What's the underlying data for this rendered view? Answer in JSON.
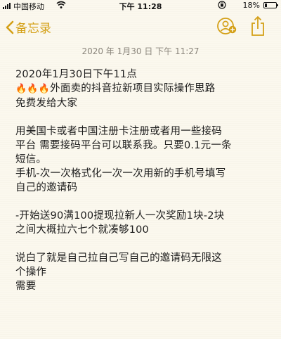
{
  "status_bar": {
    "carrier": "中国移动",
    "time": "下午 11:28",
    "battery_pct": "18%",
    "battery_level": 0.18
  },
  "nav": {
    "back_label": "备忘录",
    "accent_color": "#d4a017"
  },
  "note": {
    "date": "2020 年 1月30 日 下午 11:27",
    "lines": [
      "2020年1月30日下午11点",
      "外面卖的抖音拉新项目实际操作思路",
      "免费发给大家",
      "",
      "用美国卡或者中国注册卡注册或者用一些接码",
      "平台 需要接码平台可以联系我。只要0.1元一条",
      "短信。",
      "手机-次一次格式化一次一次用新的手机号填写",
      "自己的邀请码",
      "",
      "-开始送90满100提现拉新人一次奖励1块-2块",
      "之间大概拉六七个就凑够100",
      "",
      "说白了就是自己拉自己写自己的邀请码无限这",
      "个操作",
      "需要"
    ]
  },
  "icons": {
    "fire": "fire-emoji-icon",
    "back": "chevron-left-icon",
    "share_contact": "person-add-icon",
    "share": "share-icon"
  }
}
